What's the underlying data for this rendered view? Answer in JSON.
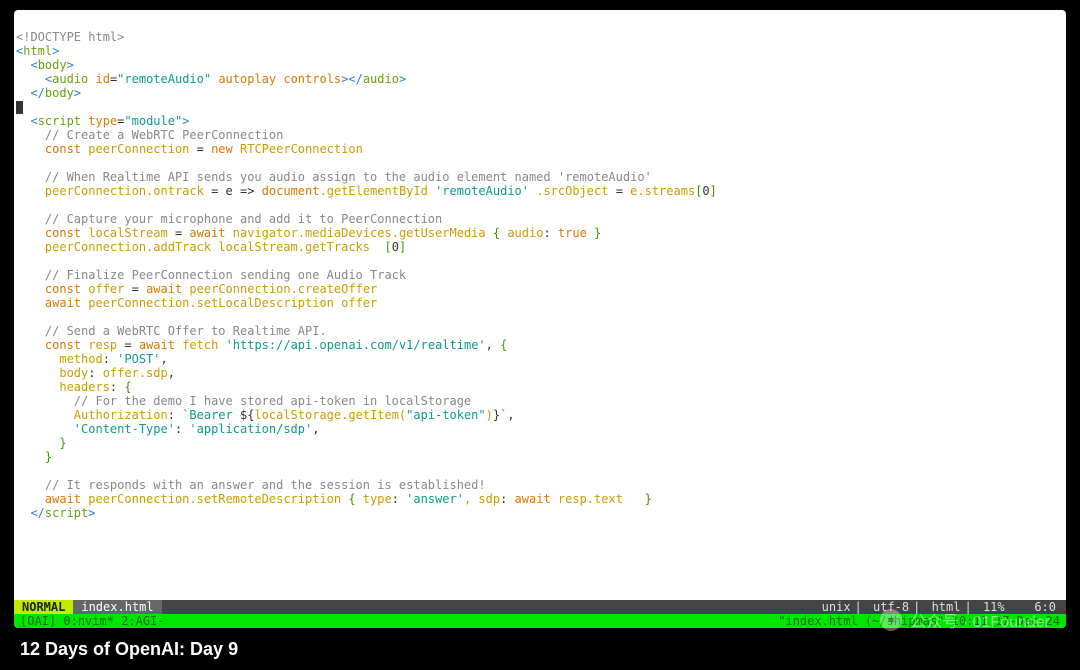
{
  "code": {
    "l01": "<!DOCTYPE html>",
    "l02a": "<",
    "l02b": "html",
    "l02c": ">",
    "l03a": "  <",
    "l03b": "body",
    "l03c": ">",
    "l04a": "    <",
    "l04b": "audio",
    "l04c": " id",
    "l04d": "=",
    "l04e": "\"remoteAudio\"",
    "l04f": " autoplay controls",
    "l04g": "></",
    "l04h": "audio",
    "l04i": ">",
    "l05a": "  </",
    "l05b": "body",
    "l05c": ">",
    "l07a": "  <",
    "l07b": "script",
    "l07c": " type",
    "l07d": "=",
    "l07e": "\"module\"",
    "l07f": ">",
    "l08": "    // Create a WebRTC PeerConnection",
    "l09a": "    const",
    "l09b": " peerConnection ",
    "l09c": "=",
    "l09d": " new",
    "l09e": " RTCPeerConnection",
    "l11": "    // When Realtime API sends you audio assign to the audio element named 'remoteAudio'",
    "l12a": "    peerConnection.ontrack ",
    "l12b": "=",
    "l12c": " e ",
    "l12d": "=>",
    "l12e": " document",
    "l12f": ".getElementById ",
    "l12g": "'remoteAudio'",
    "l12h": " .srcObject ",
    "l12i": "=",
    "l12j": " e.streams",
    "l12k": "[",
    "l12l": "0",
    "l12m": "]",
    "l14": "    // Capture your microphone and add it to PeerConnection",
    "l15a": "    const",
    "l15b": " localStream ",
    "l15c": "=",
    "l15d": " await",
    "l15e": " navigator.mediaDevices.getUserMedia ",
    "l15f": "{",
    "l15g": " audio",
    "l15h": ":",
    "l15i": " true",
    "l15j": " }",
    "l16a": "    peerConnection.addTrack localStream.getTracks  ",
    "l16b": "[",
    "l16c": "0",
    "l16d": "]",
    "l18": "    // Finalize PeerConnection sending one Audio Track",
    "l19a": "    const",
    "l19b": " offer ",
    "l19c": "=",
    "l19d": " await",
    "l19e": " peerConnection.createOffer",
    "l20a": "    await",
    "l20b": " peerConnection.setLocalDescription offer",
    "l22": "    // Send a WebRTC Offer to Realtime API.",
    "l23a": "    const",
    "l23b": " resp ",
    "l23c": "=",
    "l23d": " await",
    "l23e": " fetch ",
    "l23f": "'https://api.openai.com/v1/realtime'",
    "l23g": ", ",
    "l23h": "{",
    "l24a": "      method",
    "l24b": ":",
    "l24c": " 'POST'",
    "l24d": ",",
    "l25a": "      body",
    "l25b": ":",
    "l25c": " offer.sdp",
    "l25d": ",",
    "l26a": "      headers",
    "l26b": ":",
    "l26c": " {",
    "l27": "        // For the demo I have stored api-token in localStorage",
    "l28a": "        Authorization",
    "l28b": ":",
    "l28c": " `Bearer ",
    "l28d": "${",
    "l28e": "localStorage.getItem(",
    "l28f": "\"api-token\"",
    "l28g": ")",
    "l28h": "}",
    "l28i": "`",
    "l28j": ",",
    "l29a": "        'Content-Type'",
    "l29b": ":",
    "l29c": " 'application/sdp'",
    "l29d": ",",
    "l30": "      }",
    "l31": "    }",
    "l33": "    // It responds with an answer and the session is established!",
    "l34a": "    await",
    "l34b": " peerConnection.setRemoteDescription ",
    "l34c": "{",
    "l34d": " type",
    "l34e": ":",
    "l34f": " 'answer'",
    "l34g": ", sdp",
    "l34h": ":",
    "l34i": " await",
    "l34j": " resp.text   ",
    "l34k": "}",
    "l35a": "  </",
    "l35b": "script",
    "l35c": ">"
  },
  "status": {
    "mode": "NORMAL",
    "file": "index.html",
    "enc": "unix",
    "charset": "utf-8",
    "ft": "html",
    "pct": "11%",
    "pos": "6:0"
  },
  "tmux": {
    "left": "[OAI] 0:nvim* 2:AGI-",
    "right": "\"index.html (~/shipmas\" 10:11 17-Dec-24"
  },
  "caption": "12 Days of OpenAI: Day 9",
  "watermark": "公众号 · 01Founder"
}
